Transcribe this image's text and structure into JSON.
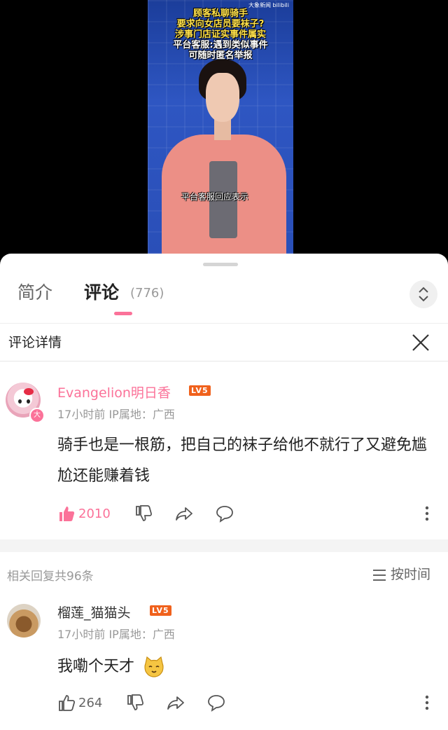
{
  "video": {
    "brand": "大象新闻 bilibili",
    "headlines": [
      "顾客私聊骑手",
      "要求向女店员要袜子?",
      "涉事门店证实事件属实",
      "平台客服:遇到类似事件",
      "可随时匿名举报"
    ],
    "caption": "平台客服回应表示"
  },
  "tabs": {
    "intro": "简介",
    "comments": "评论",
    "comment_count": "(776)"
  },
  "detail": {
    "title": "评论详情"
  },
  "comment": {
    "avatar_badge": "大",
    "username": "Evangelion明日香",
    "level": "LV5",
    "meta": "17小时前  IP属地：广西",
    "text": "骑手也是一根筋，把自己的袜子给他不就行了又避免尴尬还能赚着钱",
    "likes": "2010"
  },
  "replies": {
    "header": "相关回复共96条",
    "sort_label": "按时间"
  },
  "reply": {
    "username": "榴莲_猫猫头",
    "level": "LV5",
    "meta": "17小时前  IP属地：广西",
    "text": "我嘞个天才",
    "likes": "264"
  },
  "colors": {
    "accent": "#fb7299",
    "level_badge": "#f0611c"
  }
}
